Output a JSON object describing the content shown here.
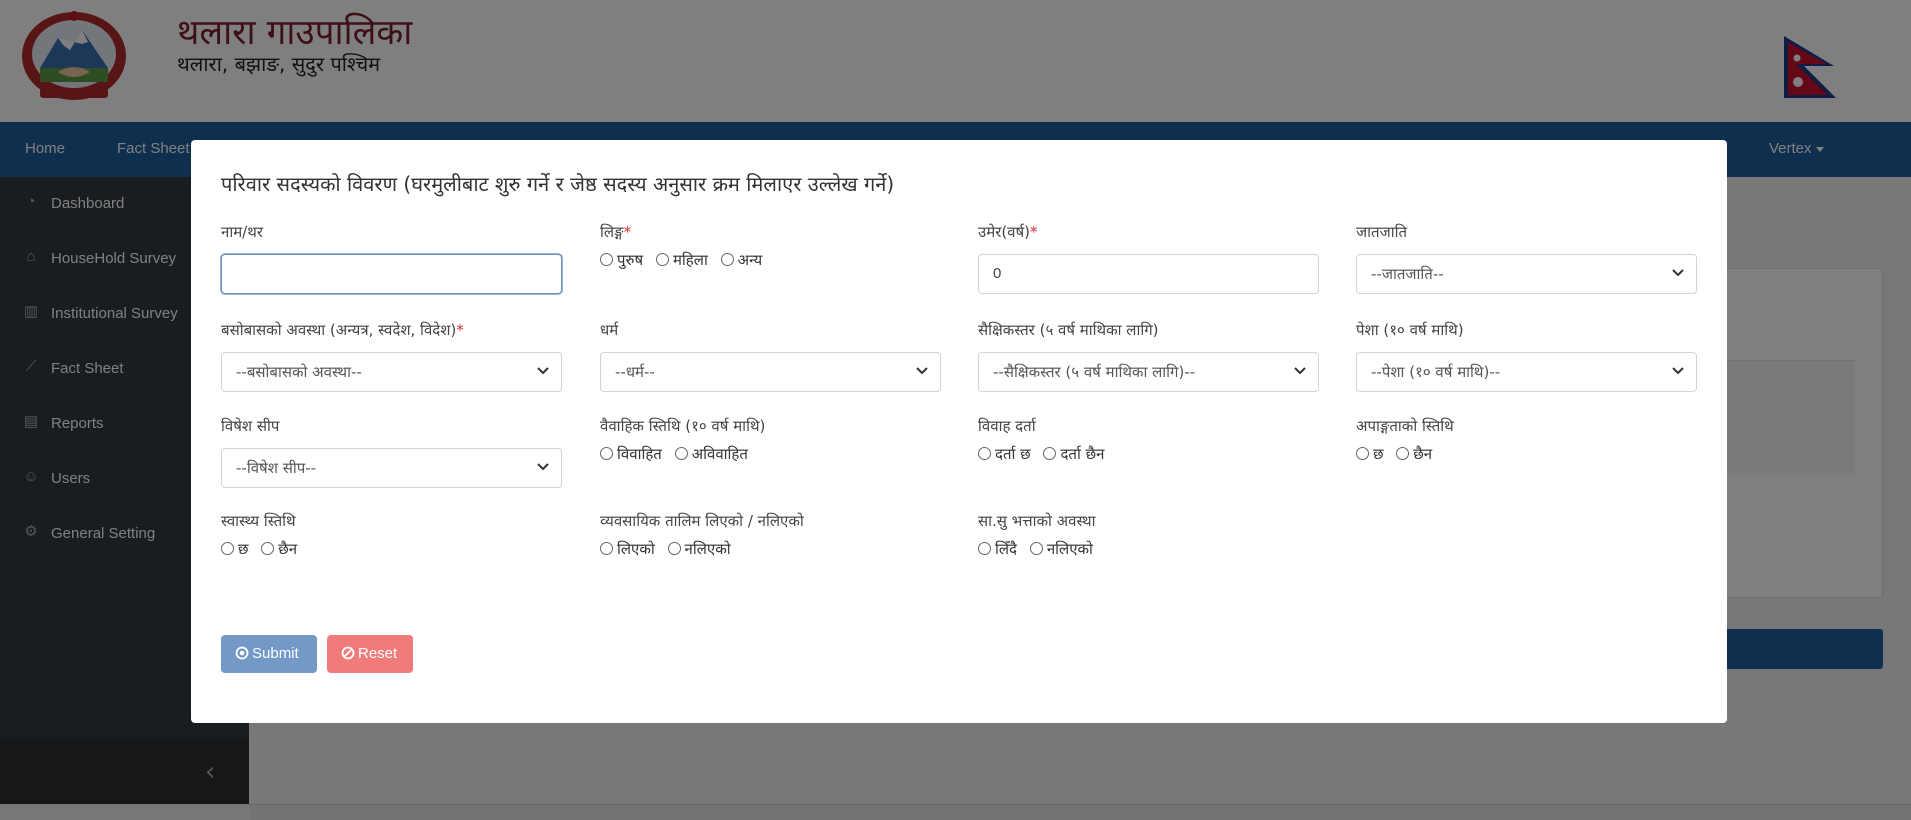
{
  "header": {
    "org_title": "थलारा गाउपालिका",
    "org_subtitle": "थलारा, बझाङ, सुदुर पश्चिम"
  },
  "navbar": {
    "items": [
      {
        "label": "Home"
      },
      {
        "label": "Fact Sheet"
      }
    ],
    "user_menu": "Vertex"
  },
  "sidebar": {
    "items": [
      {
        "label": "Dashboard",
        "icon": "dashboard-icon"
      },
      {
        "label": "HouseHold Survey",
        "icon": "home-icon"
      },
      {
        "label": "Institutional Survey",
        "icon": "institution-icon"
      },
      {
        "label": "Fact Sheet",
        "icon": "chart-line-icon"
      },
      {
        "label": "Reports",
        "icon": "file-icon"
      },
      {
        "label": "Users",
        "icon": "user-icon"
      },
      {
        "label": "General Setting",
        "icon": "gear-icon"
      }
    ],
    "collapse_glyph": "‹"
  },
  "modal": {
    "title": "परिवार सदस्यको विवरण (घरमुलीबाट शुरु गर्ने र जेष्ठ सदस्य अनुसार क्रम मिलाएर उल्लेख गर्ने)",
    "fields": {
      "name": {
        "label": "नाम/थर",
        "value": ""
      },
      "gender": {
        "label": "लिङ्ग",
        "required": "*",
        "options": [
          "पुरुष",
          "महिला",
          "अन्य"
        ]
      },
      "age": {
        "label": "उमेर(वर्ष)",
        "required": "*",
        "value": "0"
      },
      "caste": {
        "label": "जातजाति",
        "selected": "--जातजाति--"
      },
      "residence": {
        "label": "बसोबासको अवस्था (अन्यत्र, स्वदेश, विदेश)",
        "required": "*",
        "selected": "--बसोबासको अवस्था--"
      },
      "religion": {
        "label": "धर्म",
        "selected": "--धर्म--"
      },
      "education": {
        "label": "सैक्षिकस्तर (५ वर्ष माथिका लागि)",
        "selected": "--सैक्षिकस्तर (५ वर्ष माथिका लागि)--"
      },
      "occupation": {
        "label": "पेशा (१० वर्ष माथि)",
        "selected": "--पेशा (१० वर्ष माथि)--"
      },
      "skill": {
        "label": "विषेश सीप",
        "selected": "--विषेश सीप--"
      },
      "marital": {
        "label": "वैवाहिक स्तिथि (१० वर्ष माथि)",
        "options": [
          "विवाहित",
          "अविवाहित"
        ]
      },
      "marriage_reg": {
        "label": "विवाह दर्ता",
        "options": [
          "दर्ता छ",
          "दर्ता छैन"
        ]
      },
      "disability": {
        "label": "अपाङ्गताको स्तिथि",
        "options": [
          "छ",
          "छैन"
        ]
      },
      "health": {
        "label": "स्वास्थ्य स्तिथि",
        "options": [
          "छ",
          "छैन"
        ]
      },
      "training": {
        "label": "व्यवसायिक तालिम लिएको / नलिएको",
        "options": [
          "लिएको",
          "नलिएको"
        ]
      },
      "allowance": {
        "label": "सा.सु भत्ताको अवस्था",
        "options": [
          "लिँदै",
          "नलिएको"
        ]
      }
    },
    "buttons": {
      "submit": "Submit",
      "reset": "Reset"
    }
  },
  "colors": {
    "navbar": "#1f5f9e",
    "sidebar": "#343a40",
    "org_title": "#7a1f2e",
    "submit": "#7399c6",
    "reset": "#f07b7b",
    "required": "#d62b2b"
  }
}
